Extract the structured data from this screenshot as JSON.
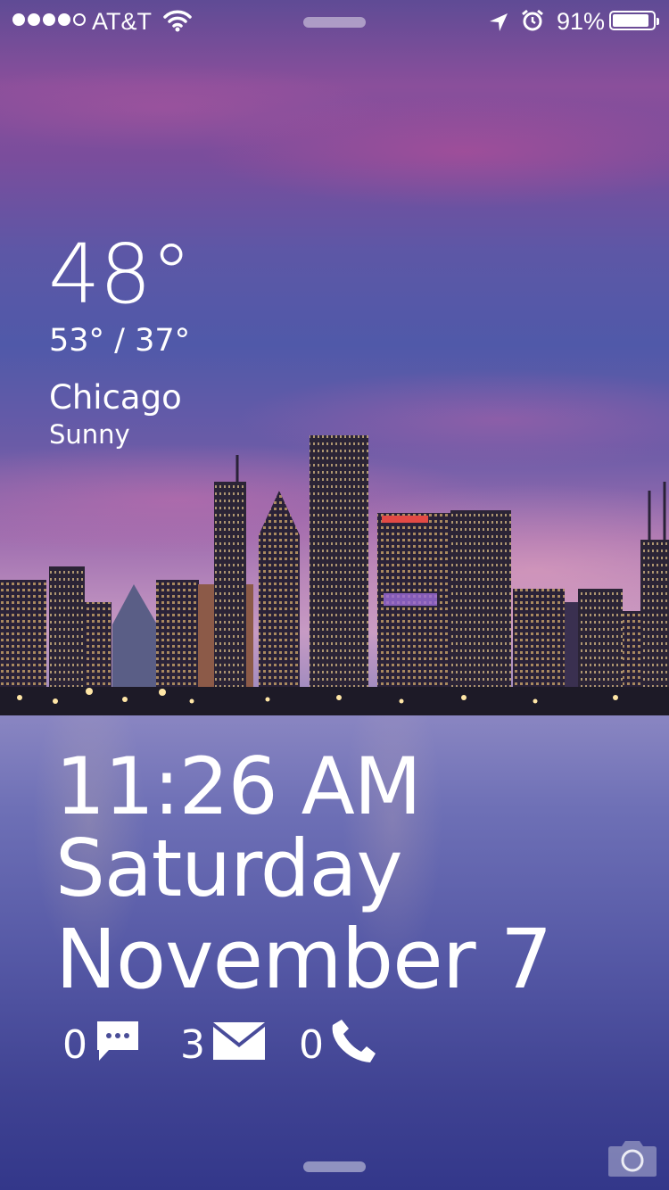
{
  "status_bar": {
    "signal_bars_filled": 4,
    "signal_bars_total": 5,
    "carrier": "AT&T",
    "battery_percent_label": "91%",
    "battery_level": 0.91,
    "icons": [
      "wifi-icon",
      "location-arrow-icon",
      "alarm-clock-icon",
      "battery-icon"
    ]
  },
  "weather": {
    "temperature": "48°",
    "high_low": "53° / 37°",
    "city": "Chicago",
    "condition": "Sunny"
  },
  "clock": {
    "time": "11:26 AM",
    "weekday": "Saturday",
    "date": "November 7"
  },
  "notifications": [
    {
      "type": "messages",
      "count": "0",
      "icon": "message-bubble-icon"
    },
    {
      "type": "mail",
      "count": "3",
      "icon": "envelope-icon"
    },
    {
      "type": "calls",
      "count": "0",
      "icon": "phone-icon"
    }
  ],
  "camera": {
    "icon": "camera-icon"
  },
  "colors": {
    "text": "#ffffff",
    "sky_top": "#5f4b95",
    "sky_pink": "#c79bc4",
    "water": "#5659a6"
  }
}
